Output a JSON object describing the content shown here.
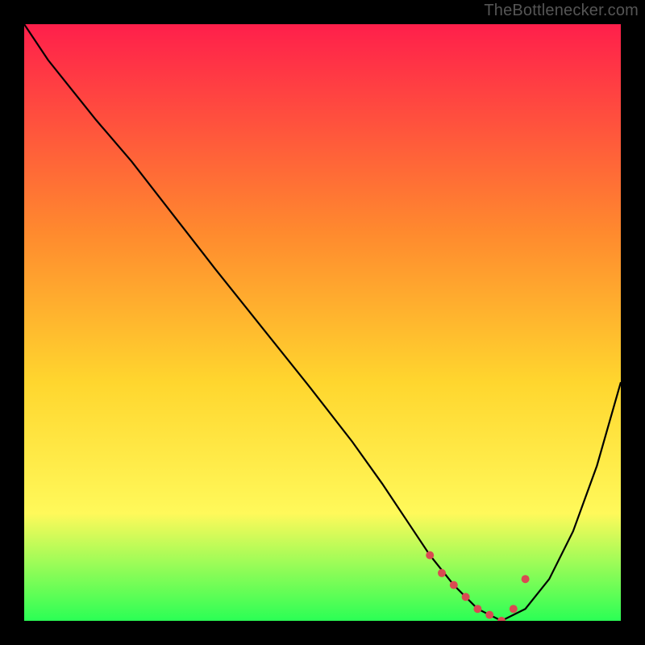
{
  "watermark": "TheBottlenecker.com",
  "colors": {
    "gradient_top": "#ff1f4b",
    "gradient_mid1": "#ff8a2e",
    "gradient_mid2": "#ffd62e",
    "gradient_mid3": "#fff95a",
    "gradient_bottom": "#2bff55",
    "curve": "#000000",
    "markers": "#d94a52",
    "background": "#000000"
  },
  "chart_data": {
    "type": "line",
    "title": "",
    "xlabel": "",
    "ylabel": "",
    "xlim": [
      0,
      100
    ],
    "ylim": [
      0,
      100
    ],
    "grid": false,
    "legend": false,
    "series": [
      {
        "name": "bottleneck-curve",
        "x": [
          0,
          4,
          8,
          12,
          18,
          25,
          32,
          40,
          48,
          55,
          60,
          64,
          68,
          72,
          76,
          80,
          84,
          88,
          92,
          96,
          100
        ],
        "y": [
          100,
          94,
          89,
          84,
          77,
          68,
          59,
          49,
          39,
          30,
          23,
          17,
          11,
          6,
          2,
          0,
          2,
          7,
          15,
          26,
          40
        ]
      }
    ],
    "markers": {
      "name": "highlight-range",
      "x": [
        68,
        70,
        72,
        74,
        76,
        78,
        80,
        82,
        84
      ],
      "y": [
        11,
        8,
        6,
        4,
        2,
        1,
        0,
        2,
        7
      ]
    }
  }
}
